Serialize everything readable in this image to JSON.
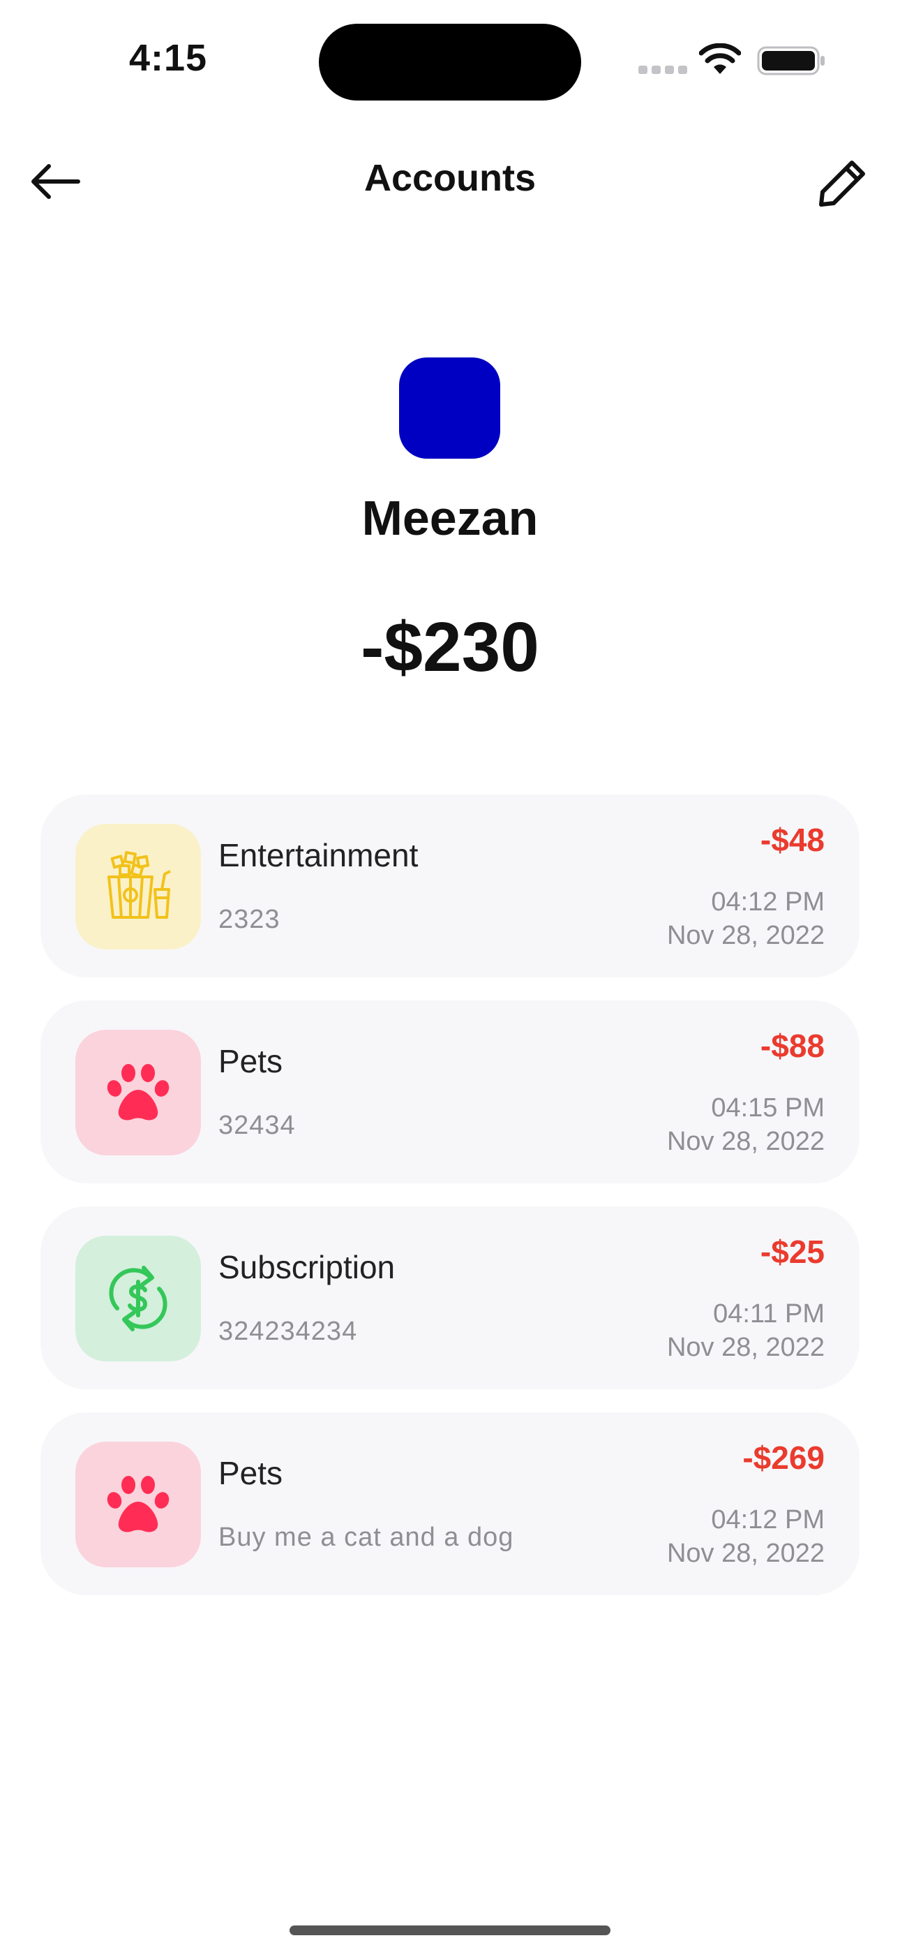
{
  "status_bar": {
    "time": "4:15"
  },
  "nav": {
    "title": "Accounts",
    "back_icon": "arrow-left-icon",
    "edit_icon": "pencil-icon"
  },
  "account": {
    "name": "Meezan",
    "balance": "-$230",
    "color": "#0000c2"
  },
  "colors": {
    "negative_amount": "#ea3b2e",
    "card_background": "#f7f7fa",
    "secondary_text": "#8e8e93"
  },
  "transactions": [
    {
      "category": "Entertainment",
      "note": "2323",
      "amount": "-$48",
      "time": "04:12 PM",
      "date": "Nov 28, 2022",
      "icon": "popcorn-icon",
      "icon_bg": "#fbf1c9",
      "icon_color": "#f2c21b"
    },
    {
      "category": "Pets",
      "note": "32434",
      "amount": "-$88",
      "time": "04:15 PM",
      "date": "Nov 28, 2022",
      "icon": "paw-icon",
      "icon_bg": "#fbd3dc",
      "icon_color": "#ff2d55"
    },
    {
      "category": "Subscription",
      "note": "324234234",
      "amount": "-$25",
      "time": "04:11 PM",
      "date": "Nov 28, 2022",
      "icon": "recurring-dollar-icon",
      "icon_bg": "#d4efdc",
      "icon_color": "#34c759"
    },
    {
      "category": "Pets",
      "note": "Buy me a cat and a dog",
      "amount": "-$269",
      "time": "04:12 PM",
      "date": "Nov 28, 2022",
      "icon": "paw-icon",
      "icon_bg": "#fbd3dc",
      "icon_color": "#ff2d55"
    }
  ]
}
